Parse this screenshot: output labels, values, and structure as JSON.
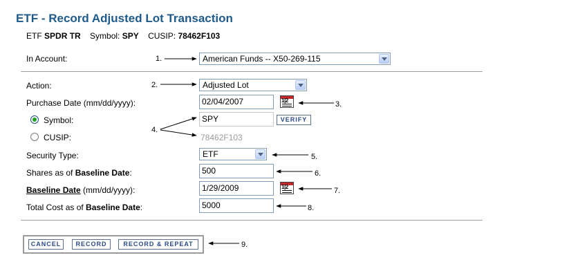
{
  "page": {
    "title": "ETF - Record Adjusted Lot Transaction",
    "security_type_label": "ETF",
    "security_name": "SPDR TR",
    "symbol_label": "Symbol:",
    "symbol_value": "SPY",
    "cusip_label": "CUSIP:",
    "cusip_value": "78462F103"
  },
  "form": {
    "account_label": "In Account:",
    "account_value": "American Funds -- X50-269-115",
    "action_label": "Action:",
    "action_value": "Adjusted Lot",
    "purchase_date_label": "Purchase Date (mm/dd/yyyy):",
    "purchase_date_value": "02/04/2007",
    "symbol_radio_label": "Symbol:",
    "symbol_input_value": "SPY",
    "verify_label": "VERIFY",
    "cusip_radio_label": "CUSIP:",
    "cusip_input_value": "78462F103",
    "security_type_field_label": "Security Type:",
    "security_type_value": "ETF",
    "shares_label_prefix": "Shares as of ",
    "shares_label_bold": "Baseline Date",
    "shares_label_suffix": ":",
    "shares_value": "500",
    "baseline_label_link": "Baseline Date",
    "baseline_label_suffix": " (mm/dd/yyyy):",
    "baseline_value": "1/29/2009",
    "cost_label_prefix": "Total Cost as of ",
    "cost_label_bold": "Baseline Date",
    "cost_label_suffix": ":",
    "cost_value": "5000"
  },
  "buttons": {
    "cancel": "CANCEL",
    "record": "RECORD",
    "record_repeat": "RECORD & REPEAT"
  },
  "calendar_icon_text": "1|2",
  "annotations": {
    "n1": "1.",
    "n2": "2.",
    "n3": "3.",
    "n4": "4.",
    "n5": "5.",
    "n6": "6.",
    "n7": "7.",
    "n8": "8.",
    "n9": "9."
  },
  "colors": {
    "title": "#1f5a8c",
    "button_text": "#2a4a88",
    "calendar_red": "#c0282c",
    "radio_selected": "#21a121"
  }
}
